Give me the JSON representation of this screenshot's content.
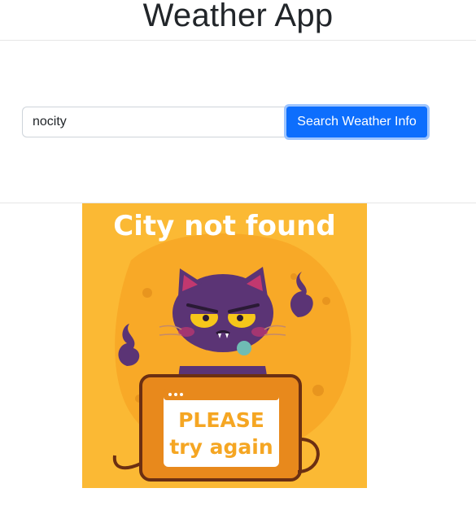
{
  "header": {
    "title": "Weather App"
  },
  "search": {
    "value": "nocity",
    "button_label": "Search Weather Info"
  },
  "result": {
    "error_title": "City not found",
    "sign_line_1": "PLEASE",
    "sign_line_2": "try again",
    "colors": {
      "background": "#fbb934",
      "cat": "#5b3475",
      "laptop": "#e8891c"
    }
  }
}
